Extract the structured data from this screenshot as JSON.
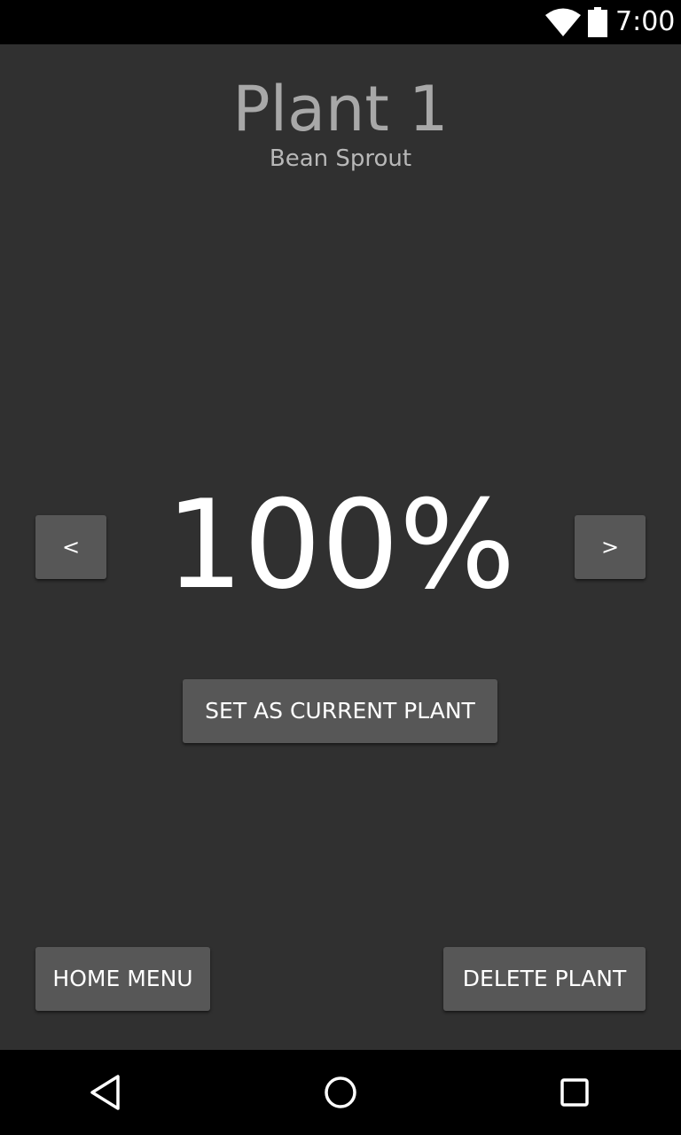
{
  "status_bar": {
    "time": "7:00",
    "icons": [
      "wifi-icon",
      "battery-icon"
    ]
  },
  "plant": {
    "title": "Plant 1",
    "type": "Bean Sprout",
    "progress": "100%"
  },
  "controls": {
    "prev_label": "<",
    "next_label": ">",
    "set_current_label": "SET AS CURRENT PLANT",
    "home_menu_label": "HOME MENU",
    "delete_plant_label": "DELETE PLANT"
  },
  "nav_bar": {
    "icons": [
      "back-icon",
      "home-icon",
      "recent-apps-icon"
    ]
  },
  "colors": {
    "background": "#303030",
    "button": "#575757",
    "bars": "#000000",
    "title": "#a8a8a8"
  }
}
